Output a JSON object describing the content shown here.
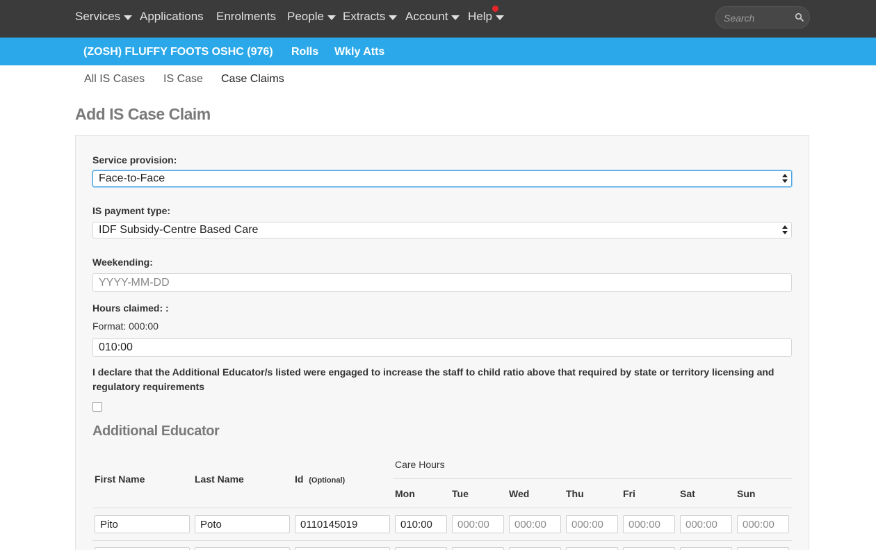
{
  "nav": {
    "items": [
      {
        "label": "Services",
        "dropdown": true
      },
      {
        "label": "Applications",
        "dropdown": false
      },
      {
        "label": "Enrolments",
        "dropdown": false
      },
      {
        "label": "People",
        "dropdown": true
      },
      {
        "label": "Extracts",
        "dropdown": true
      },
      {
        "label": "Account",
        "dropdown": true
      },
      {
        "label": "Help",
        "dropdown": true
      }
    ],
    "search_placeholder": "Search",
    "notification_color": "#e8262a"
  },
  "context_bar": {
    "service": "(ZOSH) FLUFFY FOOTS OSHC (976)",
    "links": [
      "Rolls",
      "Wkly Atts"
    ],
    "color": "#2aa8ea"
  },
  "subnav": {
    "items": [
      "All IS Cases",
      "IS Case",
      "Case Claims"
    ],
    "active": "Case Claims"
  },
  "page_title": "Add IS Case Claim",
  "form": {
    "service_provision": {
      "label": "Service provision:",
      "value": "Face-to-Face"
    },
    "payment_type": {
      "label": "IS payment type:",
      "value": "IDF Subsidy-Centre Based Care"
    },
    "weekending": {
      "label": "Weekending:",
      "placeholder": "YYYY-MM-DD",
      "value": ""
    },
    "hours_claimed": {
      "label": "Hours claimed: :",
      "format_note": "Format: 000:00",
      "value": "010:00"
    },
    "declaration": "I declare that the Additional Educator/s listed were engaged to increase the staff to child ratio above that required by state or territory licensing and regulatory requirements",
    "declaration_checked": false
  },
  "educators": {
    "title": "Additional Educator",
    "columns": {
      "first_name": "First Name",
      "last_name": "Last Name",
      "id": "Id",
      "id_note": "(Optional)",
      "care_hours": "Care Hours",
      "days": [
        "Mon",
        "Tue",
        "Wed",
        "Thu",
        "Fri",
        "Sat",
        "Sun"
      ]
    },
    "hours_placeholder": "000:00",
    "rows": [
      {
        "first_name": "Pito",
        "last_name": "Poto",
        "id": "0110145019",
        "hours": [
          "010:00",
          "",
          "",
          "",
          "",
          "",
          ""
        ]
      }
    ]
  }
}
